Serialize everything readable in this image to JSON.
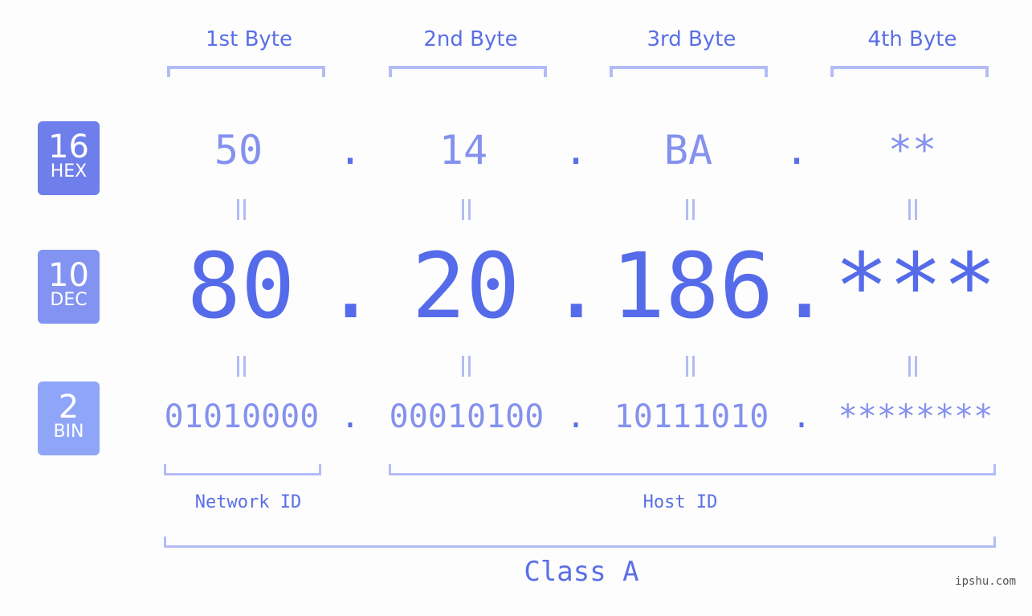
{
  "colors": {
    "hex_badge": "#6e7eea",
    "dec_badge": "#8393f2",
    "bin_badge": "#8fa6f8",
    "accent": "#556be9",
    "light_value": "#8591ee",
    "bracket": "#b3bcf6",
    "watermark": "#555555"
  },
  "byte_headers": [
    "1st Byte",
    "2nd Byte",
    "3rd Byte",
    "4th Byte"
  ],
  "badges": {
    "hex": {
      "num": "16",
      "label": "HEX"
    },
    "dec": {
      "num": "10",
      "label": "DEC"
    },
    "bin": {
      "num": "2",
      "label": "BIN"
    }
  },
  "separator": ".",
  "hex_values": [
    "50",
    "14",
    "BA",
    "**"
  ],
  "dec_values": [
    "80",
    "20",
    "186",
    "***"
  ],
  "bin_values": [
    "01010000",
    "00010100",
    "10111010",
    "********"
  ],
  "network_id_label": "Network ID",
  "host_id_label": "Host ID",
  "class_label": "Class A",
  "watermark": "ipshu.com"
}
